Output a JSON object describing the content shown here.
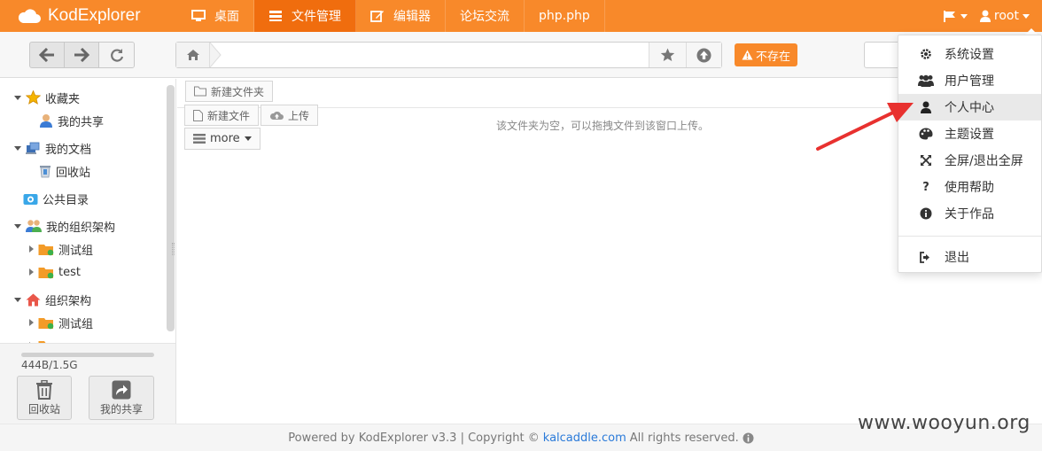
{
  "app": {
    "brand": "KodExplorer"
  },
  "nav": {
    "items": [
      {
        "label": "桌面",
        "icon": "monitor-icon",
        "active": false
      },
      {
        "label": "文件管理",
        "icon": "list-icon",
        "active": true
      },
      {
        "label": "编辑器",
        "icon": "edit-icon",
        "active": false
      },
      {
        "label": "论坛交流",
        "icon": "",
        "active": false
      },
      {
        "label": "php.php",
        "icon": "",
        "active": false
      }
    ]
  },
  "user": {
    "name": "root"
  },
  "toolbar": {
    "address_value": "",
    "not_exist_label": "不存在"
  },
  "sidebar": {
    "tree": [
      {
        "label": "收藏夹",
        "icon": "star-icon",
        "level": 0,
        "expand": "open"
      },
      {
        "label": "我的共享",
        "icon": "user-share-icon",
        "level": 1,
        "expand": "none"
      },
      {
        "label": "我的文档",
        "icon": "documents-icon",
        "level": 0,
        "expand": "open"
      },
      {
        "label": "回收站",
        "icon": "recycle-icon",
        "level": 1,
        "expand": "none"
      },
      {
        "label": "公共目录",
        "icon": "public-folder-icon",
        "level": 0,
        "expand": "none"
      },
      {
        "label": "我的组织架构",
        "icon": "group-icon",
        "level": 0,
        "expand": "open"
      },
      {
        "label": "测试组",
        "icon": "folder-icon",
        "level": 1,
        "expand": "closed"
      },
      {
        "label": "test",
        "icon": "folder-icon",
        "level": 1,
        "expand": "closed"
      },
      {
        "label": "组织架构",
        "icon": "house-icon",
        "level": 0,
        "expand": "open"
      },
      {
        "label": "测试组",
        "icon": "folder-icon",
        "level": 1,
        "expand": "closed"
      }
    ],
    "quota_text": "444B/1.5G",
    "quota_fraction": 0.0,
    "recycle_label": "回收站",
    "share_label": "我的共享"
  },
  "main": {
    "new_folder_label": "新建文件夹",
    "new_file_label": "新建文件",
    "upload_label": "上传",
    "more_label": "more",
    "empty_message": "该文件夹为空，可以拖拽文件到该窗口上传。"
  },
  "dropdown": {
    "items": [
      {
        "label": "系统设置",
        "icon": "gear-icon"
      },
      {
        "label": "用户管理",
        "icon": "users-icon"
      },
      {
        "label": "个人中心",
        "icon": "user-icon"
      },
      {
        "label": "主题设置",
        "icon": "palette-icon"
      },
      {
        "label": "全屏/退出全屏",
        "icon": "fullscreen-icon"
      },
      {
        "label": "使用帮助",
        "icon": "question-icon"
      },
      {
        "label": "关于作品",
        "icon": "info-icon"
      }
    ],
    "logout_label": "退出",
    "hovered_index": 2
  },
  "footer": {
    "prefix": "Powered by KodExplorer v3.3 | Copyright ©",
    "link": "kalcaddle.com",
    "suffix": "All rights reserved."
  },
  "watermark": "www.wooyun.org",
  "colors": {
    "accent": "#f8892a",
    "accent_active": "#f06d0e",
    "annotation_arrow": "#e8312f"
  }
}
